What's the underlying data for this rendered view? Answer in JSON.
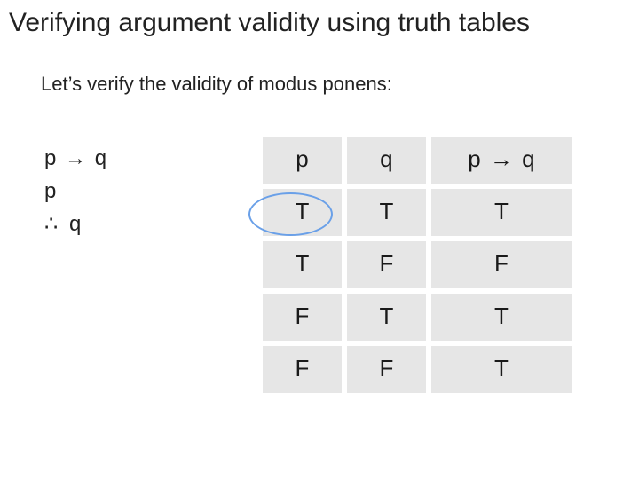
{
  "title": "Verifying argument validity using truth tables",
  "intro": "Let’s verify the validity of modus ponens:",
  "symbols": {
    "arrow": "→",
    "therefore": "∴"
  },
  "argument": {
    "premise1_left": "p",
    "premise1_right": "q",
    "premise2": "p",
    "conclusion": "q"
  },
  "chart_data": {
    "type": "table",
    "title": "Truth table for modus ponens",
    "columns": [
      "p",
      "q",
      "p → q"
    ],
    "rows": [
      [
        "T",
        "T",
        "T"
      ],
      [
        "T",
        "F",
        "F"
      ],
      [
        "F",
        "T",
        "T"
      ],
      [
        "F",
        "F",
        "T"
      ]
    ],
    "highlighted_row_index": 0
  }
}
